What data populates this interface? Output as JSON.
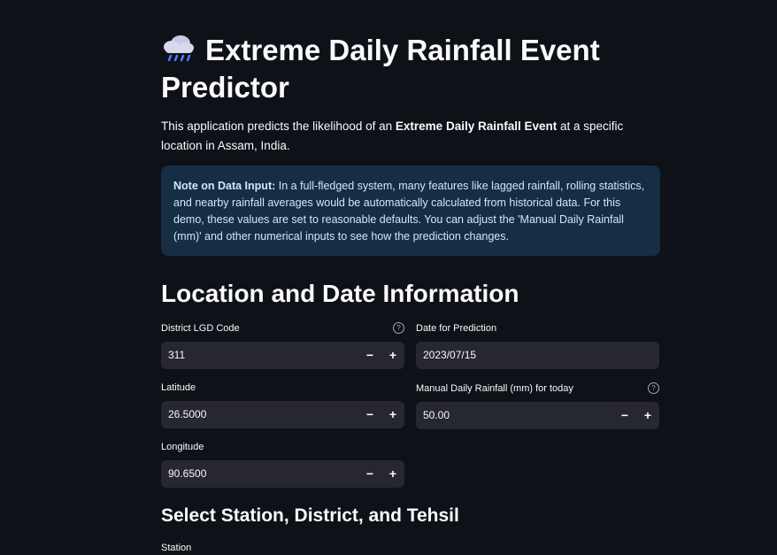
{
  "header": {
    "emoji_icon": "cloud-with-rain-icon",
    "title": "Extreme Daily Rainfall Event Predictor"
  },
  "intro": {
    "before": "This application predicts the likelihood of an ",
    "bold": "Extreme Daily Rainfall Event",
    "after": " at a specific location in Assam, India."
  },
  "info_box": {
    "bold": "Note on Data Input:",
    "text": " In a full-fledged system, many features like lagged rainfall, rolling statistics, and nearby rainfall averages would be automatically calculated from historical data. For this demo, these values are set to reasonable defaults. You can adjust the 'Manual Daily Rainfall (mm)' and other numerical inputs to see how the prediction changes.",
    "color": "#172d43"
  },
  "section1": {
    "title": "Location and Date Information"
  },
  "fields": {
    "district": {
      "label": "District LGD Code",
      "value": "311",
      "help": "?"
    },
    "date": {
      "label": "Date for Prediction",
      "value": "2023/07/15"
    },
    "latitude": {
      "label": "Latitude",
      "value": "26.5000"
    },
    "rainfall": {
      "label": "Manual Daily Rainfall (mm) for today",
      "value": "50.00",
      "help": "?"
    },
    "longitude": {
      "label": "Longitude",
      "value": "90.6500"
    }
  },
  "stepper": {
    "minus": "−",
    "plus": "+"
  },
  "section2": {
    "title": "Select Station, District, and Tehsil",
    "station_label": "Station"
  },
  "colors": {
    "background": "#0e1117",
    "input_bg": "#262730",
    "info_text": "#c7ebff"
  }
}
